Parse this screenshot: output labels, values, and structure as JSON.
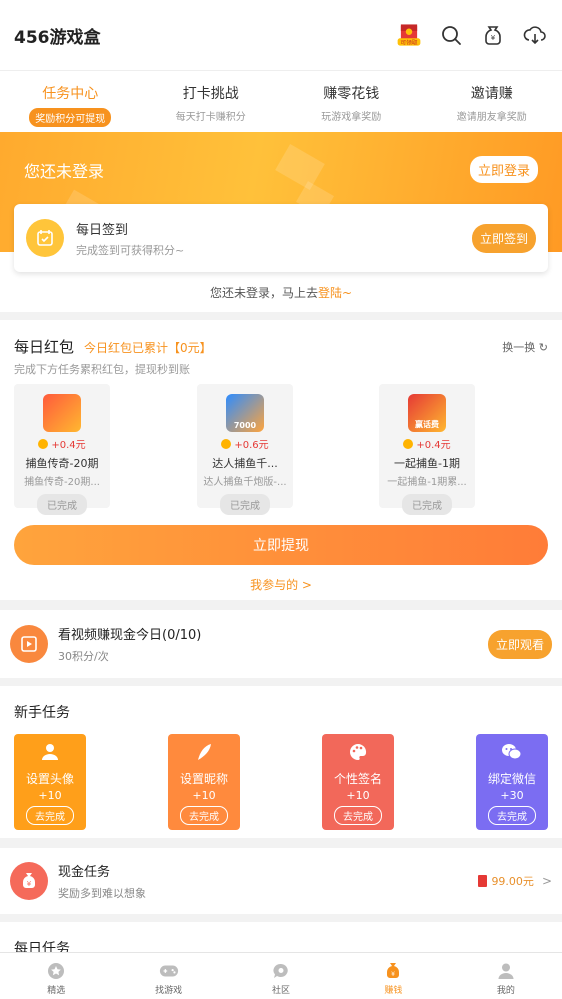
{
  "header": {
    "title": "456游戏盒",
    "badge_text": "可领取"
  },
  "tabs": [
    {
      "title": "任务中心",
      "sub": "奖励积分可提现"
    },
    {
      "title": "打卡挑战",
      "sub": "每天打卡赚积分"
    },
    {
      "title": "赚零花钱",
      "sub": "玩游戏拿奖励"
    },
    {
      "title": "邀请赚",
      "sub": "邀请朋友拿奖励"
    }
  ],
  "hero": {
    "status": "您还未登录",
    "login_button": "立即登录",
    "sign_title": "每日签到",
    "sign_sub": "完成签到可获得积分~",
    "sign_button": "立即签到",
    "note": "您还未登录，马上去",
    "note_link": "登陆~"
  },
  "redpack": {
    "title": "每日红包",
    "tag": "今日红包已累计【0元】",
    "refresh": "换一换",
    "desc": "完成下方任务累积红包，提现秒到账",
    "games": [
      {
        "reward": "+0.4元",
        "name": "捕鱼传奇-20期",
        "desc": "捕鱼传奇-20期...",
        "status": "已完成"
      },
      {
        "reward": "+0.6元",
        "name": "达人捕鱼千...",
        "desc": "达人捕鱼千炮版-...",
        "status": "已完成",
        "icon_text": "7000"
      },
      {
        "reward": "+0.4元",
        "name": "一起捕鱼-1期",
        "desc": "一起捕鱼-1期累...",
        "status": "已完成",
        "icon_text": "赢话费"
      }
    ],
    "withdraw_button": "立即提现",
    "participate": "我参与的 >"
  },
  "video": {
    "title": "看视频赚现金今日(0/10)",
    "sub": "30积分/次",
    "button": "立即观看"
  },
  "newbie": {
    "title": "新手任务",
    "tasks": [
      {
        "label": "设置头像",
        "points": "+10",
        "button": "去完成",
        "color": "#ff9f1a"
      },
      {
        "label": "设置昵称",
        "points": "+10",
        "button": "去完成",
        "color": "#ff8a3d"
      },
      {
        "label": "个性签名",
        "points": "+10",
        "button": "去完成",
        "color": "#f2685a"
      },
      {
        "label": "绑定微信",
        "points": "+30",
        "button": "去完成",
        "color": "#7b6df2"
      }
    ]
  },
  "cash": {
    "title": "现金任务",
    "sub": "奖励多到难以想象",
    "amount": "99.00元"
  },
  "daily": {
    "title": "每日任务"
  },
  "nav": [
    {
      "label": "精选"
    },
    {
      "label": "找游戏"
    },
    {
      "label": "社区"
    },
    {
      "label": "赚钱"
    },
    {
      "label": "我的"
    }
  ]
}
